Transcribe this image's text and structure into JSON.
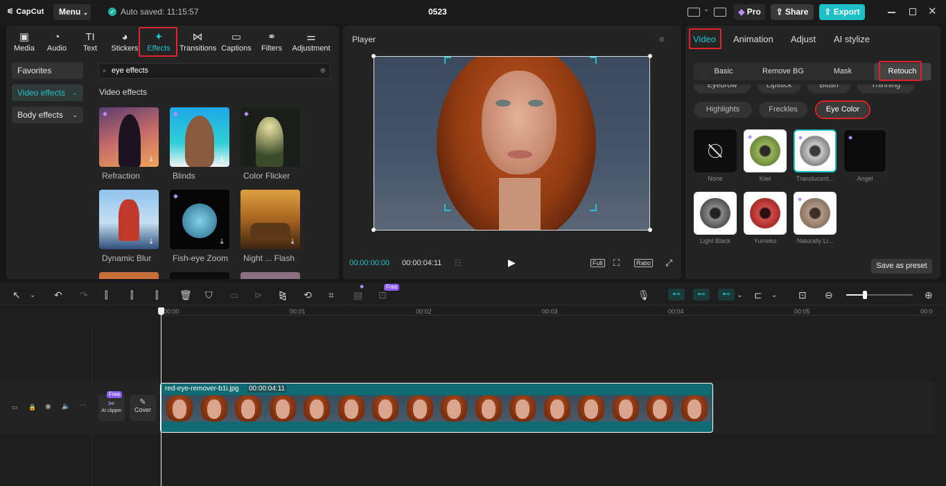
{
  "titlebar": {
    "logo": "CapCut",
    "menu": "Menu",
    "autosave": "Auto saved: 11:15:57",
    "project": "0523",
    "pro": "Pro",
    "share": "Share",
    "export": "Export"
  },
  "left": {
    "tabs": [
      {
        "label": "Media",
        "icon": "media-icon"
      },
      {
        "label": "Audio",
        "icon": "audio-icon"
      },
      {
        "label": "Text",
        "icon": "text-icon"
      },
      {
        "label": "Stickers",
        "icon": "stickers-icon"
      },
      {
        "label": "Effects",
        "icon": "effects-icon"
      },
      {
        "label": "Transitions",
        "icon": "transitions-icon"
      },
      {
        "label": "Captions",
        "icon": "captions-icon"
      },
      {
        "label": "Filters",
        "icon": "filters-icon"
      },
      {
        "label": "Adjustment",
        "icon": "adjustment-icon"
      }
    ],
    "side": [
      "Favorites",
      "Video effects",
      "Body effects"
    ],
    "search_value": "eye effects",
    "section": "Video effects",
    "effects": [
      "Refraction",
      "Blinds",
      "Color Flicker",
      "Dynamic Blur",
      "Fish-eye Zoom",
      "Night ... Flash"
    ]
  },
  "player": {
    "title": "Player",
    "current": "00:00:00:00",
    "total": "00:00:04:11",
    "full": "Full",
    "ratio": "Ratio"
  },
  "right": {
    "tabs": [
      "Video",
      "Animation",
      "Adjust",
      "AI stylize"
    ],
    "subtabs": [
      "Basic",
      "Remove BG",
      "Mask",
      "Retouch"
    ],
    "hidden_row": [
      "Eyebrow",
      "Lipstick",
      "Blush",
      "Thinning"
    ],
    "pills": [
      "Highlights",
      "Freckles",
      "Eye Color"
    ],
    "swatches": [
      "None",
      "Kiwi",
      "Translucent...",
      "Angel",
      "Light Black",
      "Yumeko",
      "Naturally Li..."
    ],
    "save_preset": "Save as preset"
  },
  "timeline": {
    "free": "Free",
    "ticks": [
      "00:00",
      "00:01",
      "00:02",
      "00:03",
      "00:04",
      "00:05",
      "00:0"
    ],
    "clip_name": "red-eye-remover-b1i.jpg",
    "clip_duration": "00:00:04:11",
    "ai_clipper": "AI clipper",
    "cover": "Cover"
  }
}
